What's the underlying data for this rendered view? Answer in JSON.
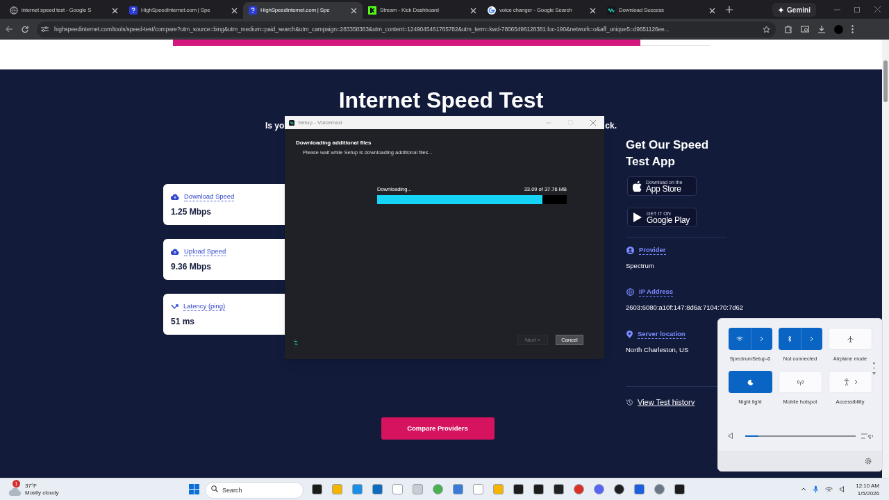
{
  "browser": {
    "tabs": [
      {
        "title": "internet speed test - Google S",
        "selected": false
      },
      {
        "title": "HighSpeedInternet.com | Spe",
        "selected": false
      },
      {
        "title": "HighSpeedInternet.com | Spe",
        "selected": true
      },
      {
        "title": "Stream - Kick Dashboard",
        "selected": false
      },
      {
        "title": "voice changer - Google Search",
        "selected": false
      },
      {
        "title": "Download Success",
        "selected": false
      }
    ],
    "assistant_button": "Gemini",
    "url": "highspeedinternet.com/tools/speed-test/compare?utm_source=bing&utm_medium=paid_search&utm_campaign=283358363&utm_content=1249045461765782&utm_term=kwd-78065496128381:loc-190&network=o&aff_unique5=d9651126ee..."
  },
  "page": {
    "title": "Internet Speed Test",
    "subtitle_start": "Is yo",
    "subtitle_end": "ck.",
    "metrics": [
      {
        "label": "Download Speed",
        "value": "1.25 Mbps"
      },
      {
        "label": "Upload Speed",
        "value": "9.36 Mbps"
      },
      {
        "label": "Latency (ping)",
        "value": "51 ms"
      }
    ],
    "app_heading": "Get Our Speed Test App",
    "store_badges": [
      {
        "small": "Download on the",
        "large": "App Store"
      },
      {
        "small": "GET IT ON",
        "large": "Google Play"
      }
    ],
    "details": [
      {
        "label": "Provider",
        "value": "Spectrum"
      },
      {
        "label": "IP Address",
        "value": "2603:6080:a10f:147:8d6a:7104:70:7d62"
      },
      {
        "label": "Server location",
        "value": "North Charleston, US"
      }
    ],
    "history_link": "View Test history",
    "compare_button": "Compare Providers"
  },
  "installer": {
    "title": "Setup - Voicemod",
    "heading": "Downloading additional files",
    "subheading": "Please wait while Setup is downloading additional files...",
    "status": "Downloading...",
    "amount": "33.09 of 37.76 MB",
    "level": 0.87,
    "buttons": [
      {
        "label": "Next >",
        "disabled": true
      },
      {
        "label": "Cancel",
        "disabled": false
      }
    ]
  },
  "quick_settings": {
    "tiles": [
      {
        "label": "SpectrumSetup-6",
        "kind": "split",
        "on": true
      },
      {
        "label": "Not connected",
        "kind": "split",
        "on": true
      },
      {
        "label": "Airplane mode",
        "kind": "plain",
        "on": false
      },
      {
        "label": "Night light",
        "kind": "plain",
        "on": true
      },
      {
        "label": "Mobile hotspot",
        "kind": "plain",
        "on": false
      },
      {
        "label": "Accessibility",
        "kind": "arrow",
        "on": false
      }
    ],
    "volume": {
      "level": 0.12
    }
  },
  "taskbar": {
    "weather": {
      "badge": "1",
      "temperature": "37°F",
      "condition": "Mostly cloudy"
    },
    "search": {
      "placeholder": "Search"
    },
    "time": "12:10 AM",
    "date": "1/5/2026"
  }
}
